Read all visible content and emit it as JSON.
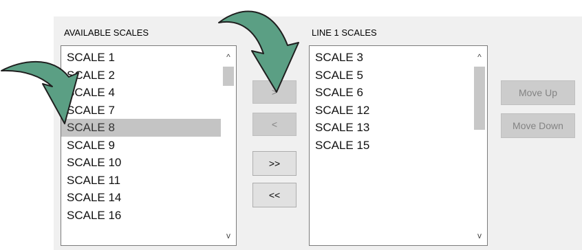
{
  "available": {
    "label": "AVAILABLE SCALES",
    "items": [
      "SCALE 1",
      "SCALE 2",
      "SCALE 4",
      "SCALE 7",
      "SCALE 8",
      "SCALE 9",
      "SCALE 10",
      "SCALE 11",
      "SCALE 14",
      "SCALE 16"
    ],
    "selected": "SCALE 8"
  },
  "line1": {
    "label": "LINE 1 SCALES",
    "items": [
      "SCALE 3",
      "SCALE 5",
      "SCALE 6",
      "SCALE 12",
      "SCALE 13",
      "SCALE 15"
    ]
  },
  "buttons": {
    "add": ">",
    "remove": "<",
    "add_all": ">>",
    "remove_all": "<<",
    "move_up": "Move Up",
    "move_down": "Move Down"
  },
  "scroll": {
    "up_glyph": "^",
    "down_glyph": "v"
  },
  "colors": {
    "dialog_bg": "#f0f0f0",
    "selection": "#c4c4c4",
    "annotation_arrow": "#5b9f84",
    "disabled_button": "#cccccc"
  },
  "icons": [
    "curved-arrow-icon"
  ]
}
